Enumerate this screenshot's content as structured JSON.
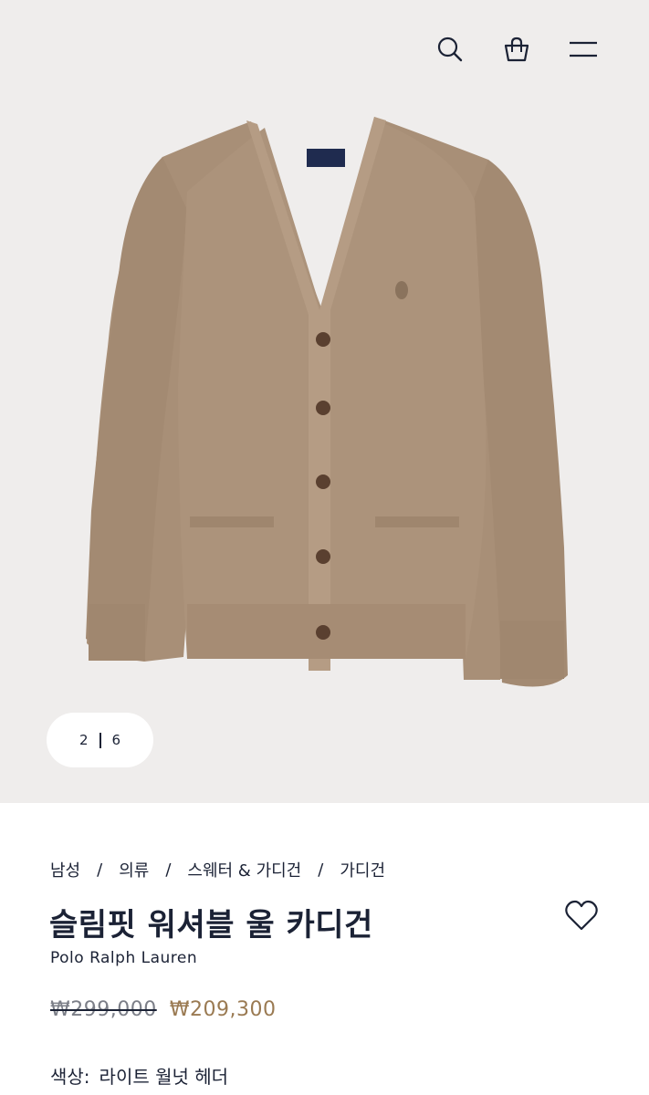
{
  "header": {
    "icons": [
      "search-icon",
      "shopping-bag-icon",
      "menu-icon"
    ]
  },
  "gallery": {
    "current": "2",
    "total": "6",
    "background": "#efedec",
    "product_color": "#a88f77"
  },
  "product": {
    "breadcrumb": [
      "남성",
      "의류",
      "스웨터 & 가디건",
      "가디건"
    ],
    "title": "슬림핏 워셔블 울 카디건",
    "brand": "Polo Ralph Lauren",
    "original_price": "₩299,000",
    "sale_price": "₩209,300",
    "color_label": "색상:",
    "color_value": "라이트 월넛 헤더",
    "sale_color": "#9a7a52"
  }
}
